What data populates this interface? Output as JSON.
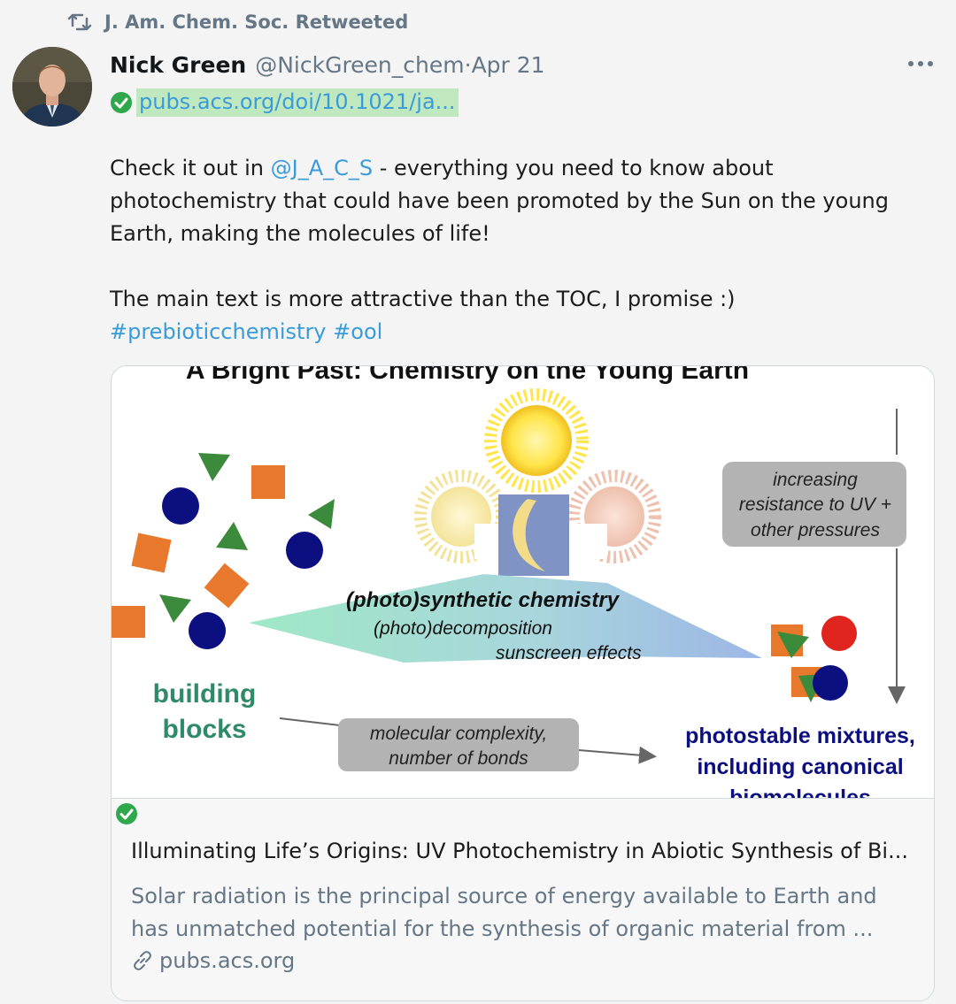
{
  "retweet": {
    "icon": "retweet-icon",
    "label": "J. Am. Chem. Soc. Retweeted"
  },
  "author": {
    "name": "Nick Green",
    "handle": "@NickGreen_chem",
    "separator": " · ",
    "date": "Apr 21"
  },
  "link": {
    "text": "pubs.acs.org/doi/10.1021/ja..."
  },
  "tweet": {
    "prefix": "Check it out in ",
    "mention": "@J_A_C_S",
    "rest": " - everything you need to know about photochemistry that could have been promoted by the Sun on the young Earth, making the molecules of life!",
    "line2": "The main text is more attractive than the TOC, I promise :)",
    "hashtag1": "#prebioticchemistry",
    "hashtag2": "#ool"
  },
  "card": {
    "image": {
      "title": "A Bright Past: Chemistry on the Young Earth",
      "building_blocks_1": "building",
      "building_blocks_2": "blocks",
      "synthetic": "(photo)synthetic chemistry",
      "decomposition": "(photo)decomposition",
      "sunscreen": "sunscreen effects",
      "increasing_1": "increasing",
      "increasing_2": "resistance to UV +",
      "increasing_3": "other pressures",
      "complexity_1": "molecular complexity,",
      "complexity_2": "number of bonds",
      "photostable_1": "photostable mixtures,",
      "photostable_2": "including canonical",
      "photostable_3": "biomolecules"
    },
    "title": "Illuminating Life’s Origins: UV Photochemistry in Abiotic Synthesis of Bi...",
    "description": "Solar radiation is the principal source of energy available to Earth and has unmatched potential for the synthesis of organic material from ...",
    "domain": "pubs.acs.org"
  },
  "colors": {
    "link": "#3a9bd9",
    "link_highlight": "#bfe8bf",
    "verified_green": "#2ea84a",
    "muted": "#657786",
    "shape_green": "#3c8a3c",
    "shape_orange": "#e8782c",
    "shape_navy": "#0b0f80",
    "shape_red": "#e0251f",
    "label_teal": "#2f8a6a"
  }
}
